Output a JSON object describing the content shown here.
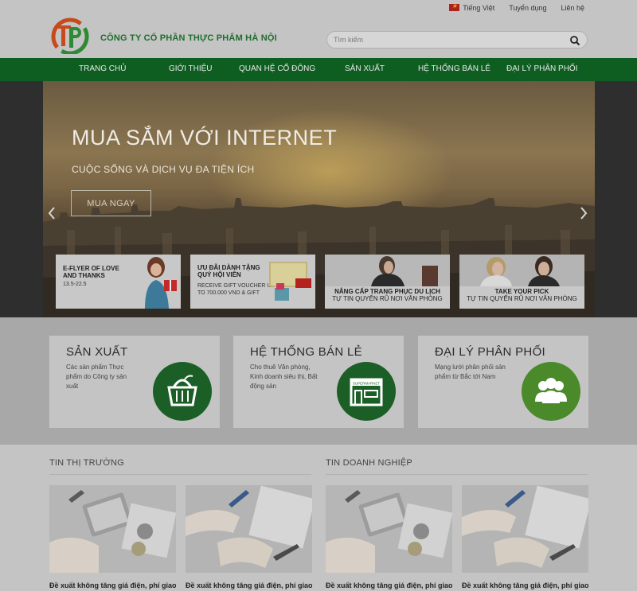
{
  "topbar": {
    "language": "Tiếng Việt",
    "recruitment": "Tuyển dụng",
    "contact": "Liên hệ"
  },
  "header": {
    "company_name": "CÔNG TY CỔ PHẦN THỰC PHẨM HÀ NỘI",
    "search_placeholder": "Tìm kiếm",
    "brand_color": "#1f6d2c"
  },
  "nav": {
    "items": [
      {
        "label": "TRANG CHỦ"
      },
      {
        "label": "GIỚI THIỆU"
      },
      {
        "label": "QUAN HỆ CỔ ĐÔNG"
      },
      {
        "label": "SẢN XUẤT"
      },
      {
        "label": "HỆ THỐNG BÁN LẺ"
      },
      {
        "label": "ĐẠI LÝ PHÂN PHỐI"
      }
    ],
    "background": "#0f5e21"
  },
  "hero": {
    "title": "MUA SẮM VỚI INTERNET",
    "subtitle": "CUỘC SỐNG VÀ DỊCH VỤ ĐA TIỆN ÍCH",
    "cta": "MUA NGAY",
    "prev_icon": "chevron-left-icon",
    "next_icon": "chevron-right-icon",
    "promos": [
      {
        "line1": "E-FLYER OF LOVE AND THANKS",
        "line2": "13.5-22.5"
      },
      {
        "line1": "ƯU ĐÃI DÀNH TẶNG QUÝ HỘI VIÊN",
        "line2": "RECEIVE GIFT VOUCHER UP TO 700.000 VND & GIFT"
      },
      {
        "line1": "NÂNG CẤP TRANG PHỤC DU LỊCH",
        "line2": "TỰ TIN QUYẾN RŨ NƠI VĂN PHÒNG"
      },
      {
        "line1": "TAKE YOUR PICK",
        "line2": "TỰ TIN QUYẾN RŨ NƠI VĂN PHÒNG"
      }
    ]
  },
  "services": [
    {
      "title": "SẢN XUẤT",
      "desc": "Các sản phẩm Thực phẩm do Công ty sản xuất",
      "icon": "basket-icon"
    },
    {
      "title": "HỆ THỐNG BÁN LẺ",
      "desc": "Cho thuê Văn phòng, Kinh doanh siêu thị, Bất động sản",
      "icon": "supermarket-icon",
      "icon_label": "SUPERMARKET"
    },
    {
      "title": "ĐẠI LÝ PHÂN PHỐI",
      "desc": "Mạng lưới phân phối sản phẩm từ Bắc tới Nam",
      "icon": "people-group-icon"
    }
  ],
  "news": {
    "market_title": "TIN THỊ TRƯỜNG",
    "business_title": "TIN DOANH NGHIỆP",
    "articles": [
      {
        "caption": "Đề xuất không tăng giá điện, phí giao"
      },
      {
        "caption": "Đề xuất không tăng giá điện, phí giao"
      },
      {
        "caption": "Đề xuất không tăng giá điện, phí giao"
      },
      {
        "caption": "Đề xuất không tăng giá điện, phí giao"
      }
    ]
  }
}
